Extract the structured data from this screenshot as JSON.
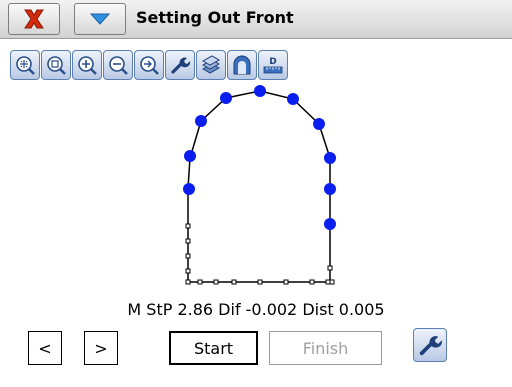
{
  "window": {
    "title": "Setting Out Front"
  },
  "toolbar": {
    "tools": [
      {
        "name": "zoom-extents-icon"
      },
      {
        "name": "zoom-window-icon"
      },
      {
        "name": "zoom-in-icon"
      },
      {
        "name": "zoom-out-icon"
      },
      {
        "name": "zoom-next-icon"
      },
      {
        "name": "settings-wrench-icon"
      },
      {
        "name": "layers-icon"
      },
      {
        "name": "tunnel-profile-icon"
      },
      {
        "name": "dimension-icon",
        "glyph": "D"
      }
    ]
  },
  "status": {
    "text": "M StP 2.86 Dif -0.002 Dist 0.005"
  },
  "buttons": {
    "prev_label": "<",
    "next_label": ">",
    "start_label": "Start",
    "finish_label": "Finish"
  },
  "colors": {
    "point_blue": "#0a1ef0",
    "close_red": "#d42a0c",
    "dropdown_blue": "#2f8fe0"
  }
}
